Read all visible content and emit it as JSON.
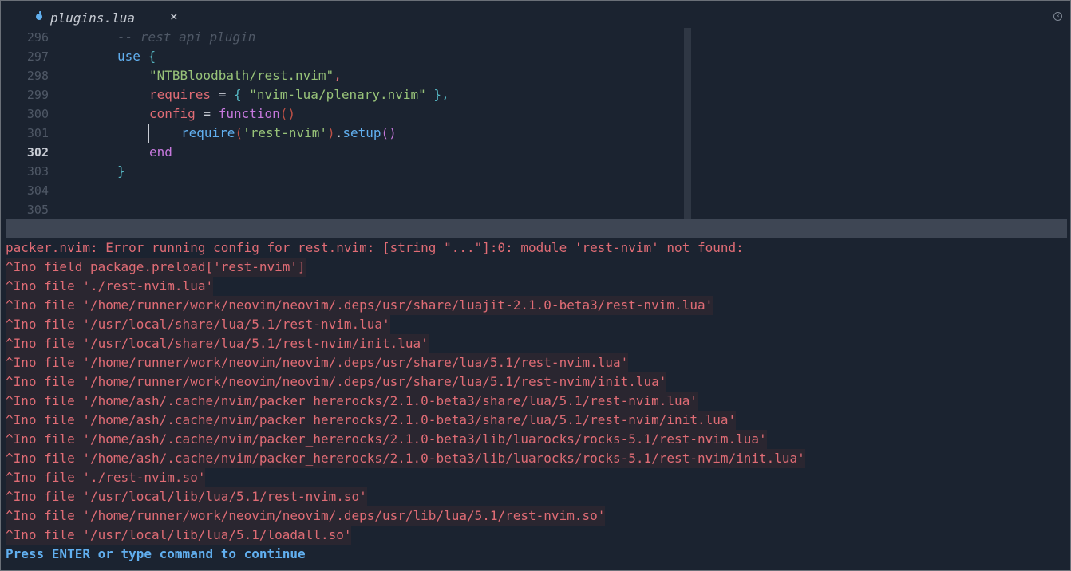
{
  "tab": {
    "icon": "lua-file-icon",
    "label": "plugins.lua",
    "close": "×"
  },
  "editor": {
    "line_numbers": [
      "296",
      "297",
      "298",
      "299",
      "300",
      "301",
      "302",
      "303",
      "304",
      "305"
    ],
    "current_line": "302",
    "code": {
      "l296_comment": "-- rest api plugin",
      "l297_kw": "use",
      "l297_brace": " {",
      "l298_str": "\"NTBBloodbath/rest.nvim\"",
      "l298_comma": ",",
      "l299_key": "requires",
      "l299_eq": " = ",
      "l299_open": "{ ",
      "l299_str": "\"nvim-lua/plenary.nvim\"",
      "l299_close": " },",
      "l300_key": "config",
      "l300_eq": " = ",
      "l300_fn": "function",
      "l300_parens": "()",
      "l301_fn": "require",
      "l301_open": "(",
      "l301_str": "'rest-nvim'",
      "l301_close": ")",
      "l301_dot": ".",
      "l301_setup": "setup",
      "l301_parens": "()",
      "l302_end": "end",
      "l303_brace": "}"
    }
  },
  "messages": {
    "error_header": "packer.nvim: Error running config for rest.nvim: [string \"...\"]:0: module 'rest-nvim' not found:",
    "lines": [
      "^Ino field package.preload['rest-nvim']",
      "^Ino file './rest-nvim.lua'",
      "^Ino file '/home/runner/work/neovim/neovim/.deps/usr/share/luajit-2.1.0-beta3/rest-nvim.lua'",
      "^Ino file '/usr/local/share/lua/5.1/rest-nvim.lua'",
      "^Ino file '/usr/local/share/lua/5.1/rest-nvim/init.lua'",
      "^Ino file '/home/runner/work/neovim/neovim/.deps/usr/share/lua/5.1/rest-nvim.lua'",
      "^Ino file '/home/runner/work/neovim/neovim/.deps/usr/share/lua/5.1/rest-nvim/init.lua'",
      "^Ino file '/home/ash/.cache/nvim/packer_hererocks/2.1.0-beta3/share/lua/5.1/rest-nvim.lua'",
      "^Ino file '/home/ash/.cache/nvim/packer_hererocks/2.1.0-beta3/share/lua/5.1/rest-nvim/init.lua'",
      "^Ino file '/home/ash/.cache/nvim/packer_hererocks/2.1.0-beta3/lib/luarocks/rocks-5.1/rest-nvim.lua'",
      "^Ino file '/home/ash/.cache/nvim/packer_hererocks/2.1.0-beta3/lib/luarocks/rocks-5.1/rest-nvim/init.lua'",
      "^Ino file './rest-nvim.so'",
      "^Ino file '/usr/local/lib/lua/5.1/rest-nvim.so'",
      "^Ino file '/home/runner/work/neovim/neovim/.deps/usr/lib/lua/5.1/rest-nvim.so'",
      "^Ino file '/usr/local/lib/lua/5.1/loadall.so'"
    ],
    "prompt": "Press ENTER or type command to continue"
  },
  "colors": {
    "background": "#1b2330",
    "error": "#e06c75",
    "prompt": "#61afef",
    "string": "#98c379",
    "keyword": "#c678dd"
  }
}
